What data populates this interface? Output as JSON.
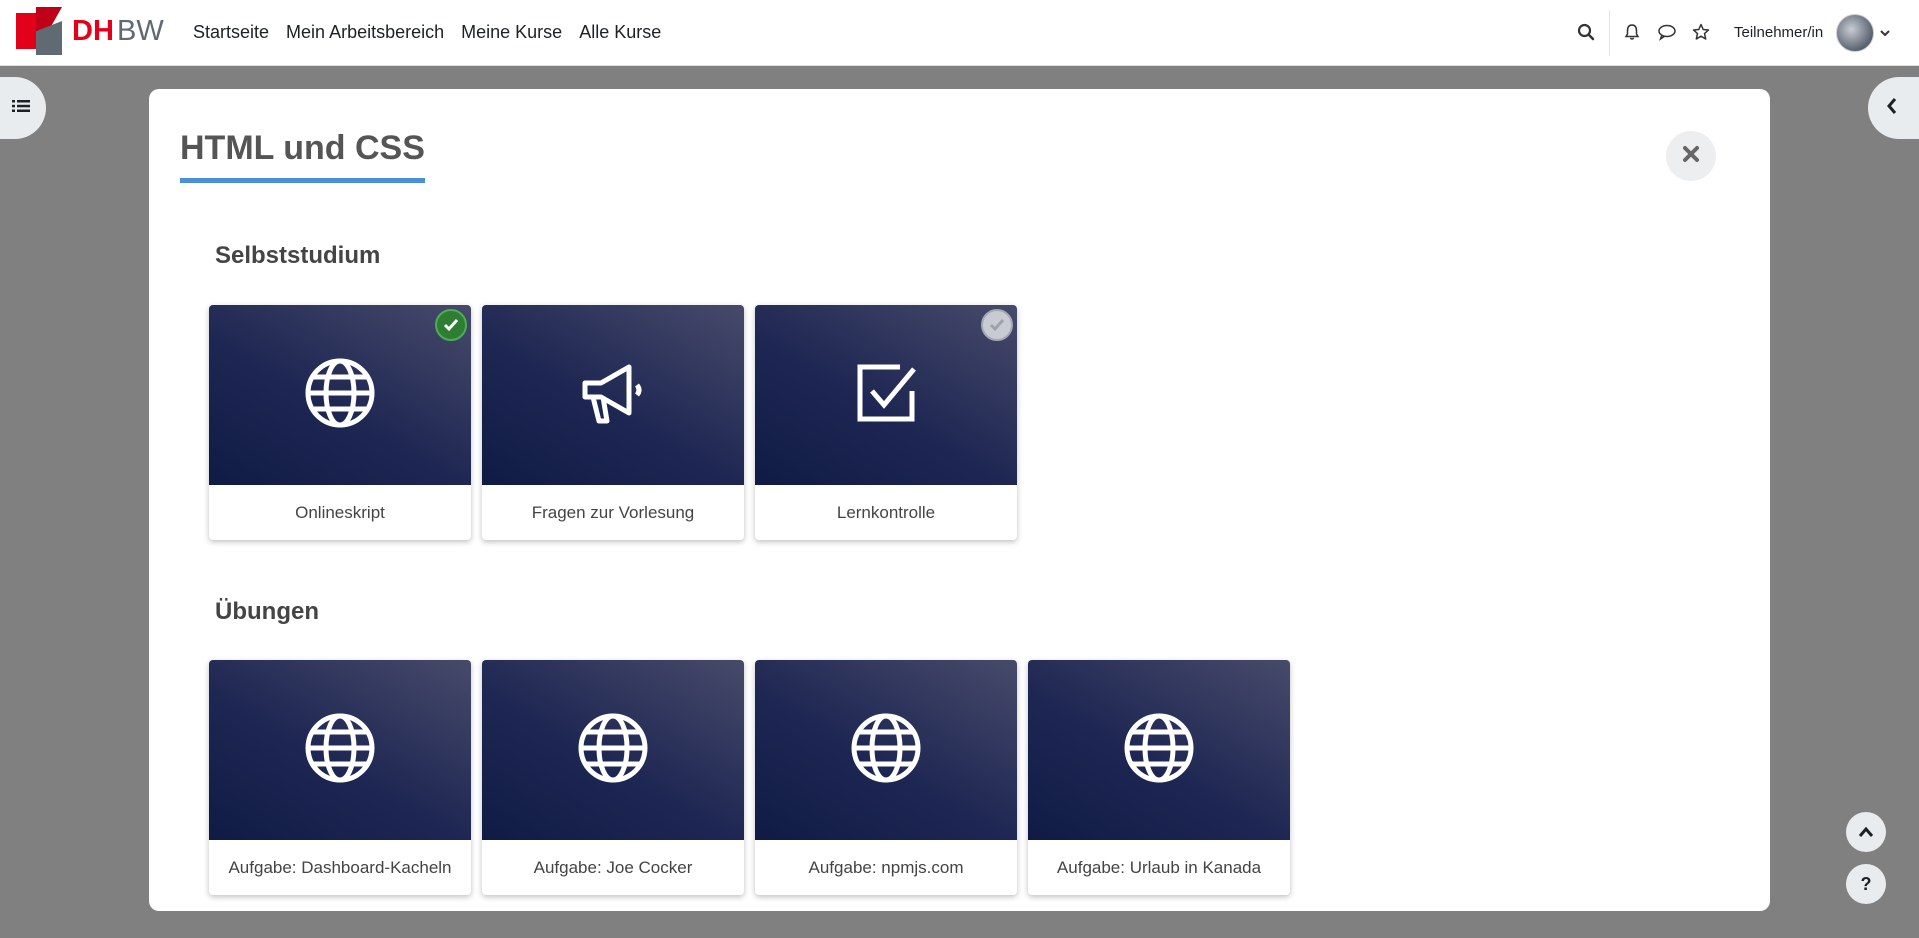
{
  "brand": {
    "dh": "DH",
    "bw": "BW"
  },
  "nav": {
    "links": [
      "Startseite",
      "Mein Arbeitsbereich",
      "Meine Kurse",
      "Alle Kurse"
    ],
    "role": "Teilnehmer/in"
  },
  "modal": {
    "title": "HTML und CSS",
    "sections": [
      {
        "title": "Selbststudium",
        "cards": [
          {
            "label": "Onlineskript",
            "icon": "globe-icon",
            "status": "completed"
          },
          {
            "label": "Fragen zur Vorlesung",
            "icon": "megaphone-icon",
            "status": "none"
          },
          {
            "label": "Lernkontrolle",
            "icon": "checkbox-icon",
            "status": "incomplete"
          }
        ]
      },
      {
        "title": "Übungen",
        "cards": [
          {
            "label": "Aufgabe: Dashboard-Kacheln",
            "icon": "globe-icon",
            "status": "none"
          },
          {
            "label": "Aufgabe: Joe Cocker",
            "icon": "globe-icon",
            "status": "none"
          },
          {
            "label": "Aufgabe: npmjs.com",
            "icon": "globe-icon",
            "status": "none"
          },
          {
            "label": "Aufgabe: Urlaub in Kanada",
            "icon": "globe-icon",
            "status": "none"
          }
        ]
      }
    ]
  },
  "float_buttons": {
    "help": "?"
  },
  "colors": {
    "accent": "#4a90d9",
    "brand_red": "#e2001a",
    "card_dark": "#0f1b45",
    "complete_green": "#2e7d32"
  }
}
